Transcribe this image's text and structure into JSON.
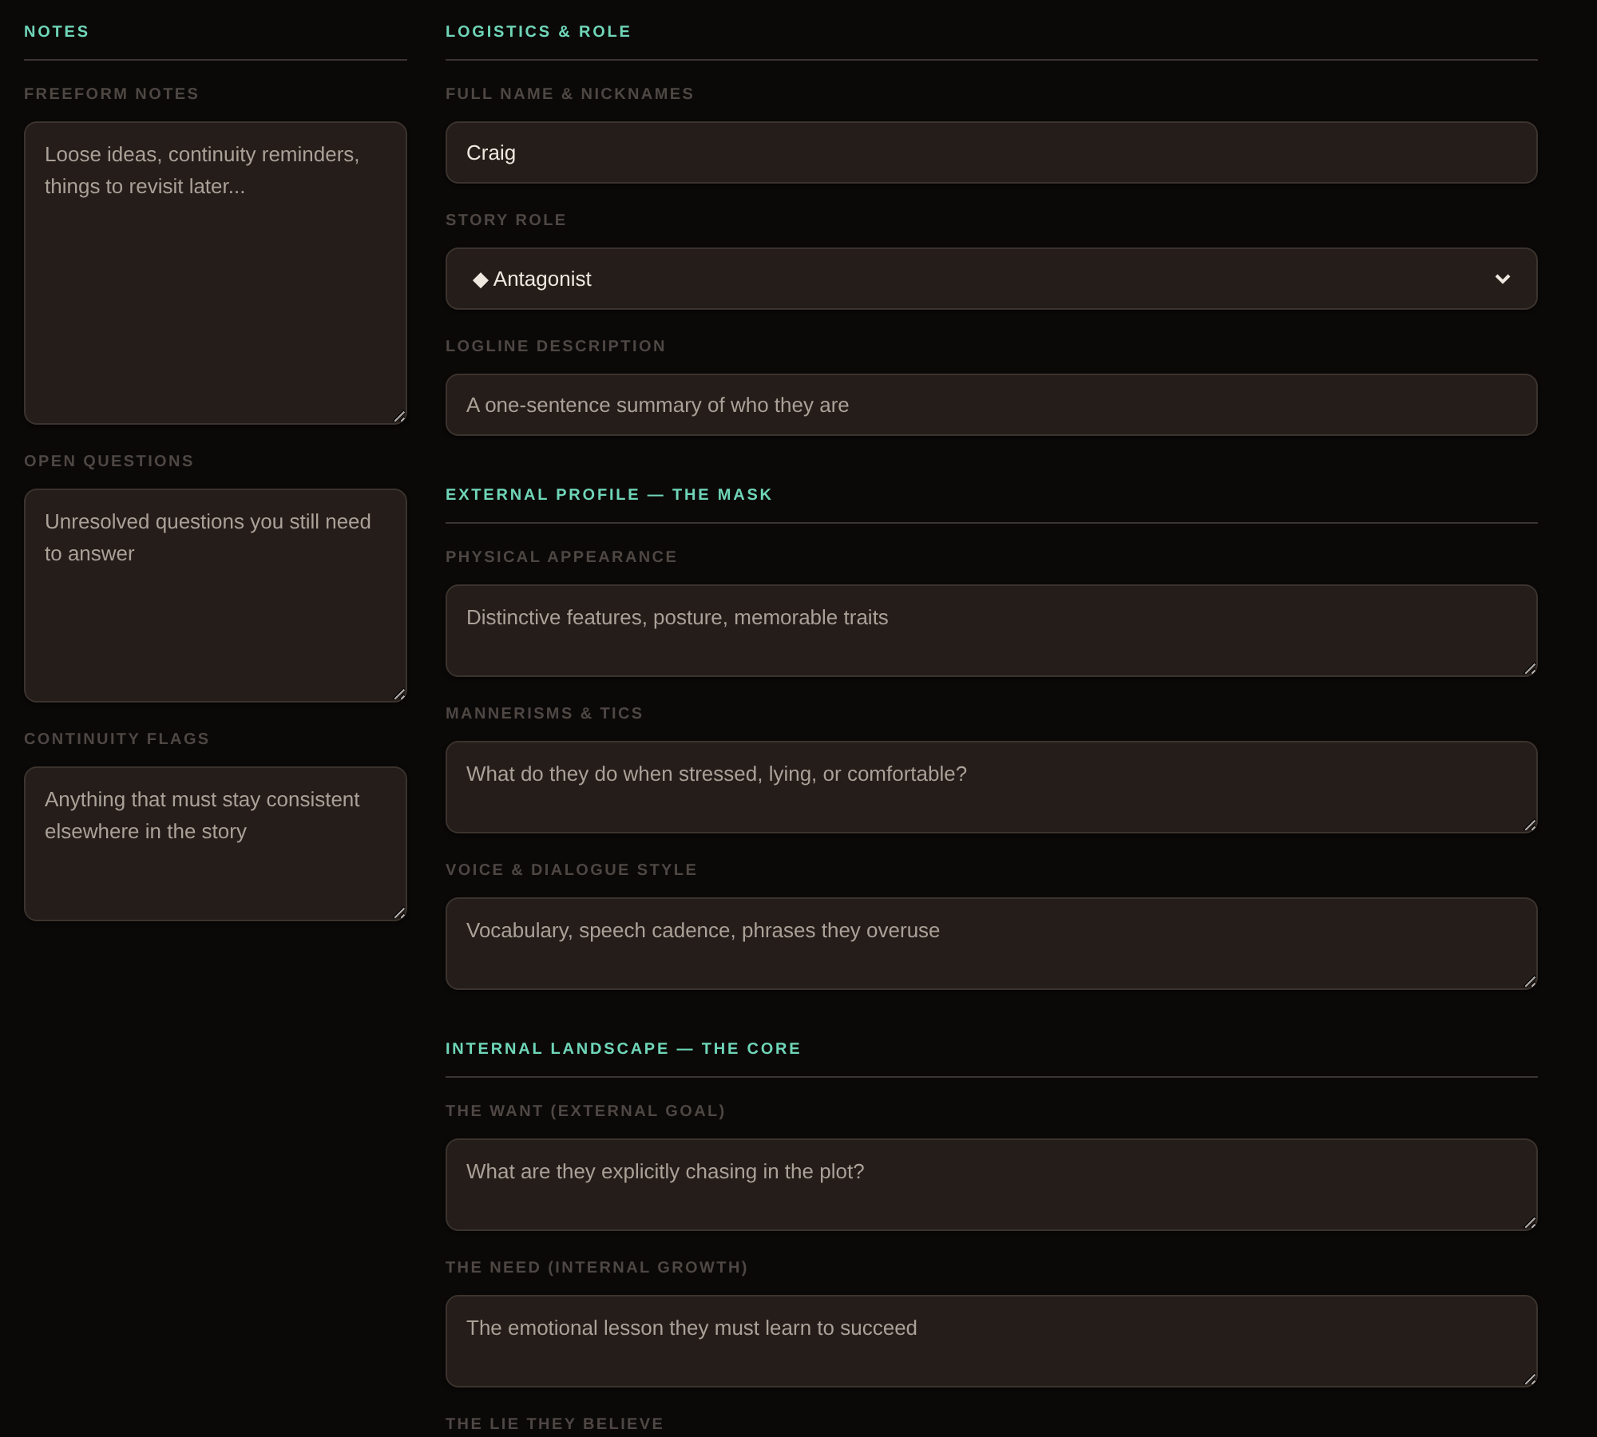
{
  "notes": {
    "title": "NOTES",
    "fields": [
      {
        "label": "FREEFORM NOTES",
        "kind": "textarea",
        "placeholder": "Loose ideas, continuity reminders, things to revisit later..."
      },
      {
        "label": "OPEN QUESTIONS",
        "kind": "textarea",
        "placeholder": "Unresolved questions you still need to answer"
      },
      {
        "label": "CONTINUITY FLAGS",
        "kind": "textarea",
        "placeholder": "Anything that must stay consistent elsewhere in the story"
      }
    ]
  },
  "sections": [
    {
      "title": "LOGISTICS & ROLE",
      "fields": [
        {
          "label": "FULL NAME & NICKNAMES",
          "kind": "input",
          "value": "Craig"
        },
        {
          "label": "STORY ROLE",
          "kind": "select",
          "value": "◆ Antagonist"
        },
        {
          "label": "LOGLINE DESCRIPTION",
          "kind": "input",
          "placeholder": "A one-sentence summary of who they are"
        }
      ]
    },
    {
      "title": "EXTERNAL PROFILE — THE MASK",
      "fields": [
        {
          "label": "PHYSICAL APPEARANCE",
          "kind": "textarea",
          "placeholder": "Distinctive features, posture, memorable traits"
        },
        {
          "label": "MANNERISMS & TICS",
          "kind": "textarea",
          "placeholder": "What do they do when stressed, lying, or comfortable?"
        },
        {
          "label": "VOICE & DIALOGUE STYLE",
          "kind": "textarea",
          "placeholder": "Vocabulary, speech cadence, phrases they overuse"
        }
      ]
    },
    {
      "title": "INTERNAL LANDSCAPE — THE CORE",
      "fields": [
        {
          "label": "THE WANT (EXTERNAL GOAL)",
          "kind": "textarea",
          "placeholder": "What are they explicitly chasing in the plot?"
        },
        {
          "label": "THE NEED (INTERNAL GROWTH)",
          "kind": "textarea",
          "placeholder": "The emotional lesson they must learn to succeed"
        },
        {
          "label": "THE LIE THEY BELIEVE",
          "kind": "label_only"
        }
      ]
    }
  ]
}
